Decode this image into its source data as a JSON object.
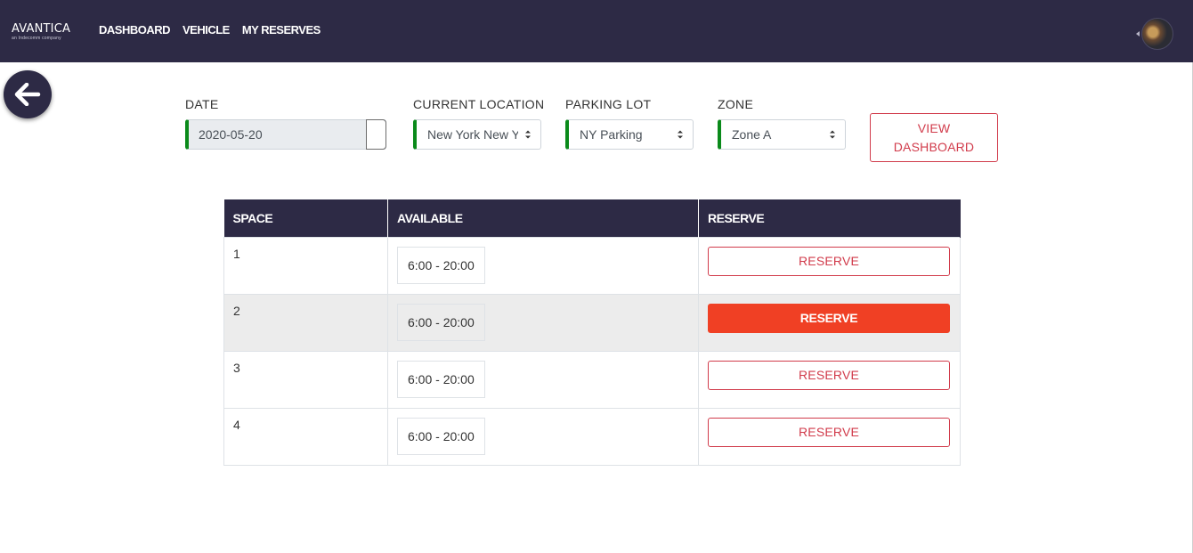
{
  "navbar": {
    "logo_text": "AVANTICA",
    "logo_sub": "an Indecomm company",
    "links": [
      "DASHBOARD",
      "VEHICLE",
      "MY RESERVES"
    ]
  },
  "filters": {
    "date": {
      "label": "DATE",
      "value": "2020-05-20"
    },
    "location": {
      "label": "CURRENT LOCATION",
      "value": "New York New York"
    },
    "lot": {
      "label": "PARKING LOT",
      "value": "NY Parking"
    },
    "zone": {
      "label": "ZONE",
      "value": "Zone A"
    },
    "view_dashboard_line1": "VIEW",
    "view_dashboard_line2": "DASHBOARD"
  },
  "table": {
    "headers": [
      "SPACE",
      "AVAILABLE",
      "RESERVE"
    ],
    "rows": [
      {
        "space": "1",
        "available": "6:00 - 20:00",
        "action": "RESERVE"
      },
      {
        "space": "2",
        "available": "6:00 - 20:00",
        "action": "RESERVE"
      },
      {
        "space": "3",
        "available": "6:00 - 20:00",
        "action": "RESERVE"
      },
      {
        "space": "4",
        "available": "6:00 - 20:00",
        "action": "RESERVE"
      }
    ]
  },
  "colors": {
    "navbar": "#2d2a45",
    "accent_red": "#d13b4b",
    "active_reserve": "#f04024",
    "field_marker": "#0a8a1a"
  },
  "icons": {
    "back": "arrow-left-icon",
    "select": "chevron-updown-icon",
    "avatar": "user-avatar"
  }
}
